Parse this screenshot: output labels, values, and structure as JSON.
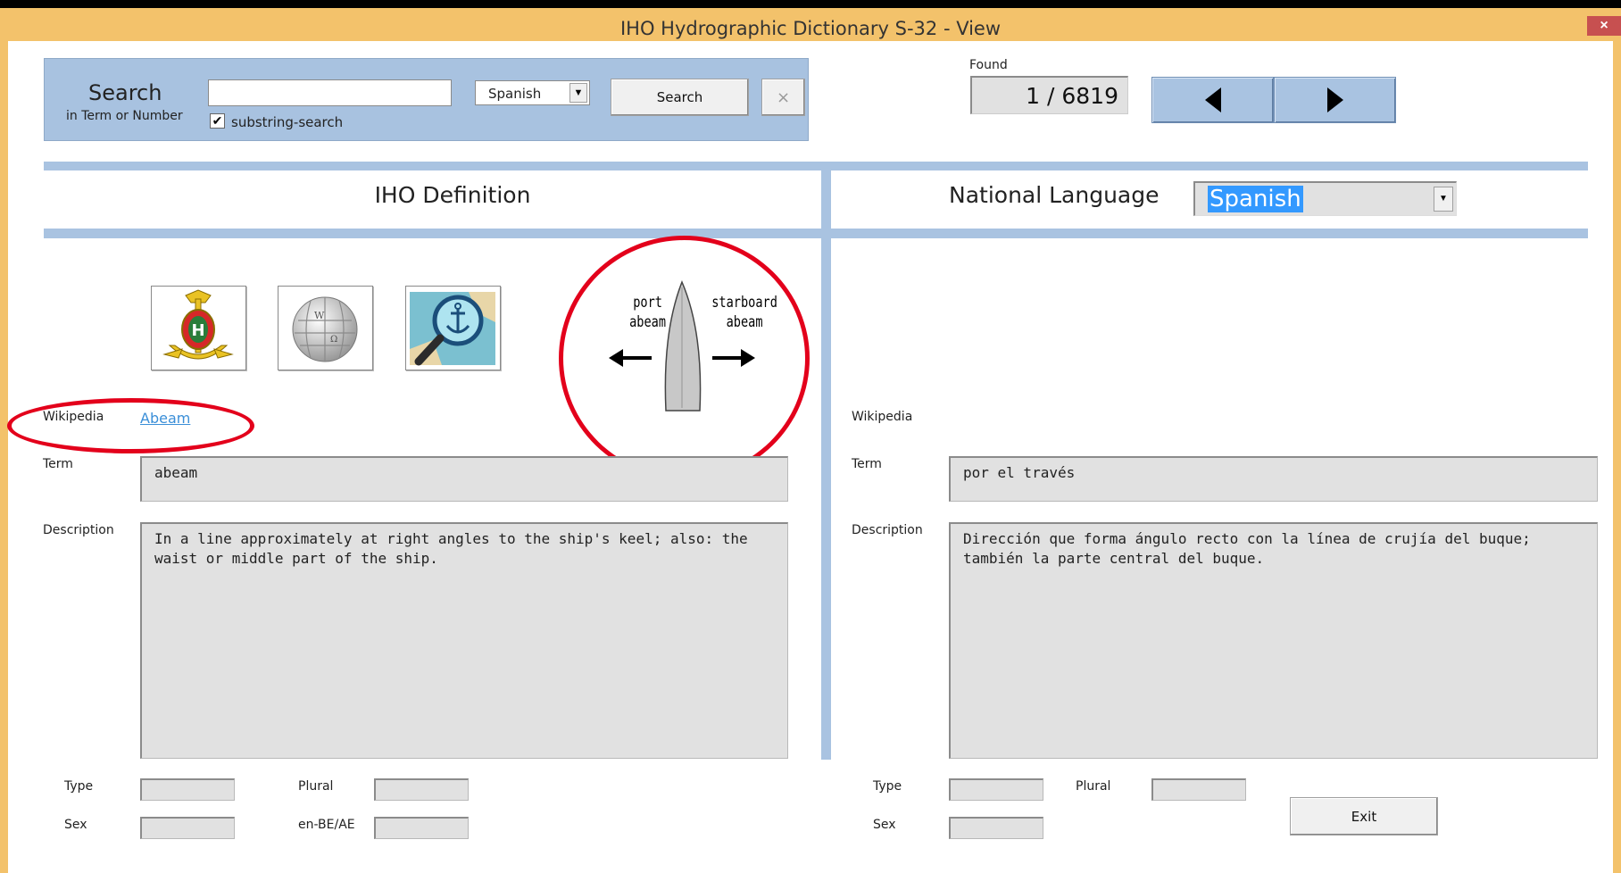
{
  "window": {
    "title": "IHO Hydrographic Dictionary S-32   -  View",
    "close_glyph": "×"
  },
  "search": {
    "heading": "Search",
    "subheading": "in Term or Number",
    "query_value": "",
    "language_selected": "Spanish",
    "substring_label": "substring-search",
    "substring_checked": true,
    "search_button": "Search",
    "clear_button": "×"
  },
  "found": {
    "label": "Found",
    "value": "1 / 6819"
  },
  "iho": {
    "heading": "IHO Definition",
    "wikipedia_label": "Wikipedia",
    "wikipedia_link": "Abeam",
    "term_label": "Term",
    "term_value": "abeam",
    "description_label": "Description",
    "description_value": "In a line approximately at right angles to the ship's keel; also: the waist or middle part of the ship.",
    "type_label": "Type",
    "plural_label": "Plural",
    "sex_label": "Sex",
    "enbe_label": "en-BE/AE",
    "type_value": "",
    "plural_value": "",
    "sex_value": "",
    "enbe_value": ""
  },
  "diagram": {
    "port_line1": "port",
    "port_line2": "abeam",
    "starboard_line1": "starboard",
    "starboard_line2": "abeam"
  },
  "national": {
    "heading": "National Language",
    "language_selected": "Spanish",
    "wikipedia_label": "Wikipedia",
    "term_label": "Term",
    "term_value": "por el través",
    "description_label": "Description",
    "description_value": "Dirección que forma ángulo recto con la línea de crujía del buque; también la parte central del buque.",
    "type_label": "Type",
    "plural_label": "Plural",
    "sex_label": "Sex",
    "type_value": "",
    "plural_value": "",
    "sex_value": ""
  },
  "exit_button": "Exit",
  "icons": [
    "iho-emblem-icon",
    "wikipedia-globe-icon",
    "chart-search-icon",
    "prev-arrow-icon",
    "next-arrow-icon"
  ],
  "colors": {
    "title_bar": "#f3c26b",
    "panel_blue": "#a8c2e0",
    "highlight_red": "#e3001b",
    "selection_blue": "#3399ff"
  }
}
